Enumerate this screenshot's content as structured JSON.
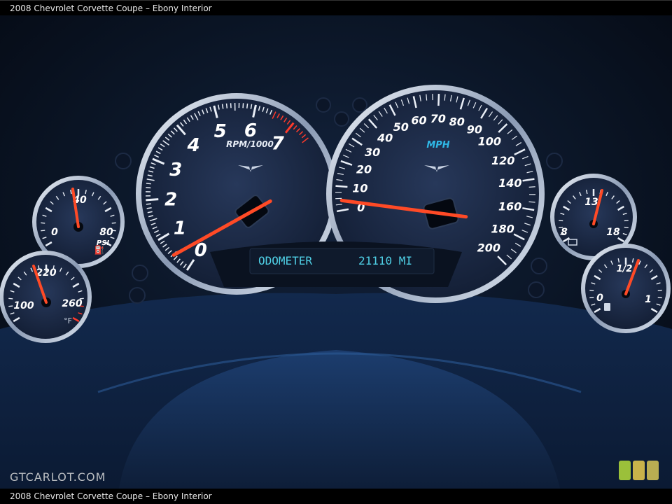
{
  "caption": "2008 Chevrolet Corvette Coupe – Ebony Interior",
  "watermark": "GTCARLOT.COM",
  "display": {
    "label": "ODOMETER",
    "value": "21110 MI"
  },
  "tachometer": {
    "unit": "RPM/1000",
    "ticks": [
      "0",
      "1",
      "2",
      "3",
      "4",
      "5",
      "6",
      "7"
    ],
    "needle_value": 1.05
  },
  "speedometer": {
    "unit": "MPH",
    "ticks": [
      "0",
      "10",
      "20",
      "30",
      "40",
      "50",
      "60",
      "70",
      "80",
      "90",
      "100",
      "120",
      "140",
      "160",
      "180",
      "200"
    ],
    "needle_value": 12
  },
  "oil_pressure": {
    "labels": [
      "0",
      "40",
      "80"
    ],
    "unit": "PSI"
  },
  "coolant_temp": {
    "labels": [
      "100",
      "220",
      "260"
    ],
    "unit": "°F"
  },
  "voltage": {
    "labels": [
      "8",
      "13",
      "18"
    ]
  },
  "fuel": {
    "labels": [
      "0",
      "1/2",
      "1"
    ]
  },
  "colors": {
    "needle": "#ff4a26",
    "display_text": "#4fd0e6",
    "mph_label": "#2fb8e6"
  }
}
